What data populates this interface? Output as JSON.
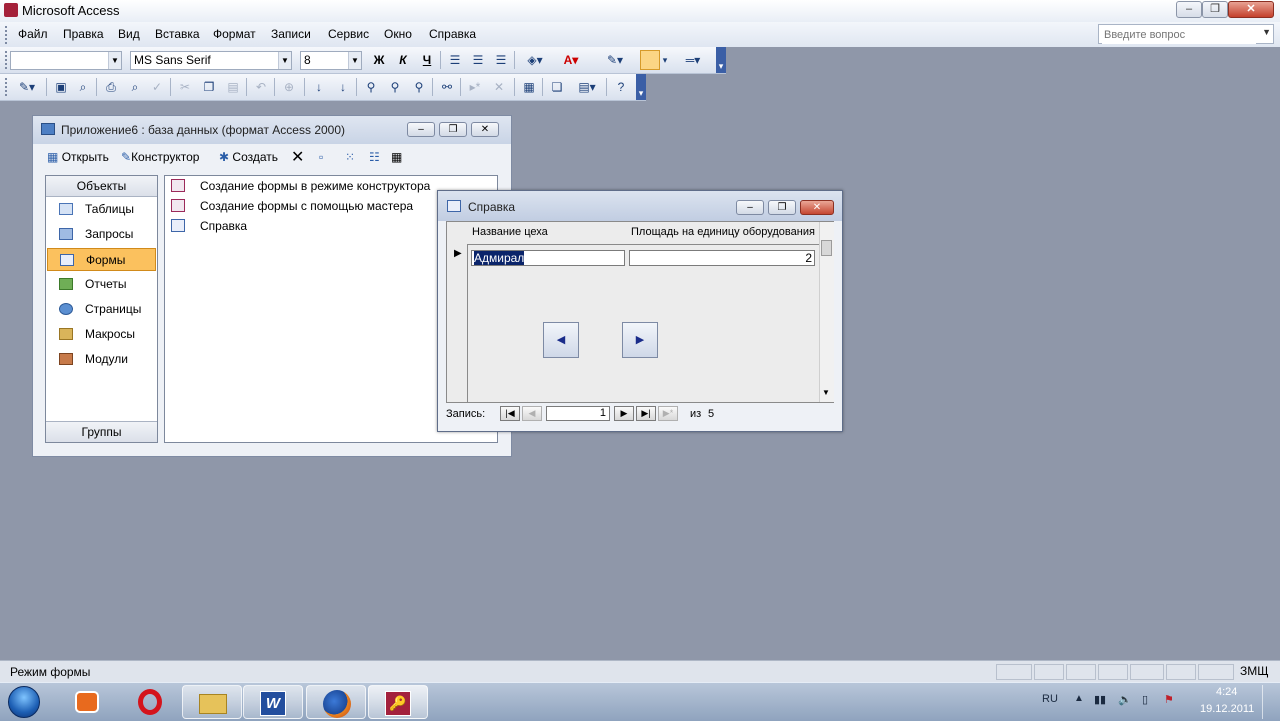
{
  "app": {
    "title": "Microsoft Access"
  },
  "menu": {
    "items": [
      "Файл",
      "Правка",
      "Вид",
      "Вставка",
      "Формат",
      "Записи",
      "Сервис",
      "Окно",
      "Справка"
    ],
    "ask_placeholder": "Введите вопрос"
  },
  "format_toolbar": {
    "object_combo": "",
    "font_combo": "MS Sans Serif",
    "size_combo": "8",
    "bold": "Ж",
    "italic": "К",
    "underline": "Ч"
  },
  "db_window": {
    "title": "Приложение6 : база данных (формат Access 2000)",
    "toolbar": {
      "open": "Открыть",
      "design": "Конструктор",
      "create": "Создать"
    },
    "objects_header": "Объекты",
    "groups_label": "Группы",
    "objects": [
      {
        "label": "Таблицы",
        "icon": "table-icon",
        "selected": false
      },
      {
        "label": "Запросы",
        "icon": "query-icon",
        "selected": false
      },
      {
        "label": "Формы",
        "icon": "form-icon",
        "selected": true
      },
      {
        "label": "Отчеты",
        "icon": "report-icon",
        "selected": false
      },
      {
        "label": "Страницы",
        "icon": "page-icon",
        "selected": false
      },
      {
        "label": "Макросы",
        "icon": "macro-icon",
        "selected": false
      },
      {
        "label": "Модули",
        "icon": "module-icon",
        "selected": false
      }
    ],
    "list_items": [
      {
        "label": "Создание формы в режиме конструктора",
        "icon": "design-form-icon"
      },
      {
        "label": "Создание формы с помощью мастера",
        "icon": "wizard-form-icon"
      },
      {
        "label": "Справка",
        "icon": "form-icon"
      }
    ]
  },
  "form_window": {
    "title": "Справка",
    "col1_header": "Название цеха",
    "col2_header": "Площадь на единицу оборудования",
    "field1_value": "Адмирал",
    "field2_value": "2",
    "record_nav": {
      "label": "Запись:",
      "current": "1",
      "of_label": "из",
      "total": "5"
    }
  },
  "status": {
    "mode": "Режим формы",
    "indicator": "ЗМЩ"
  },
  "taskbar": {
    "lang": "RU",
    "time": "4:24",
    "date": "19.12.2011"
  },
  "colors": {
    "workspace": "#8f97a9",
    "selected_object": "#fbc15e",
    "taskbar": "#9fb1c9"
  }
}
